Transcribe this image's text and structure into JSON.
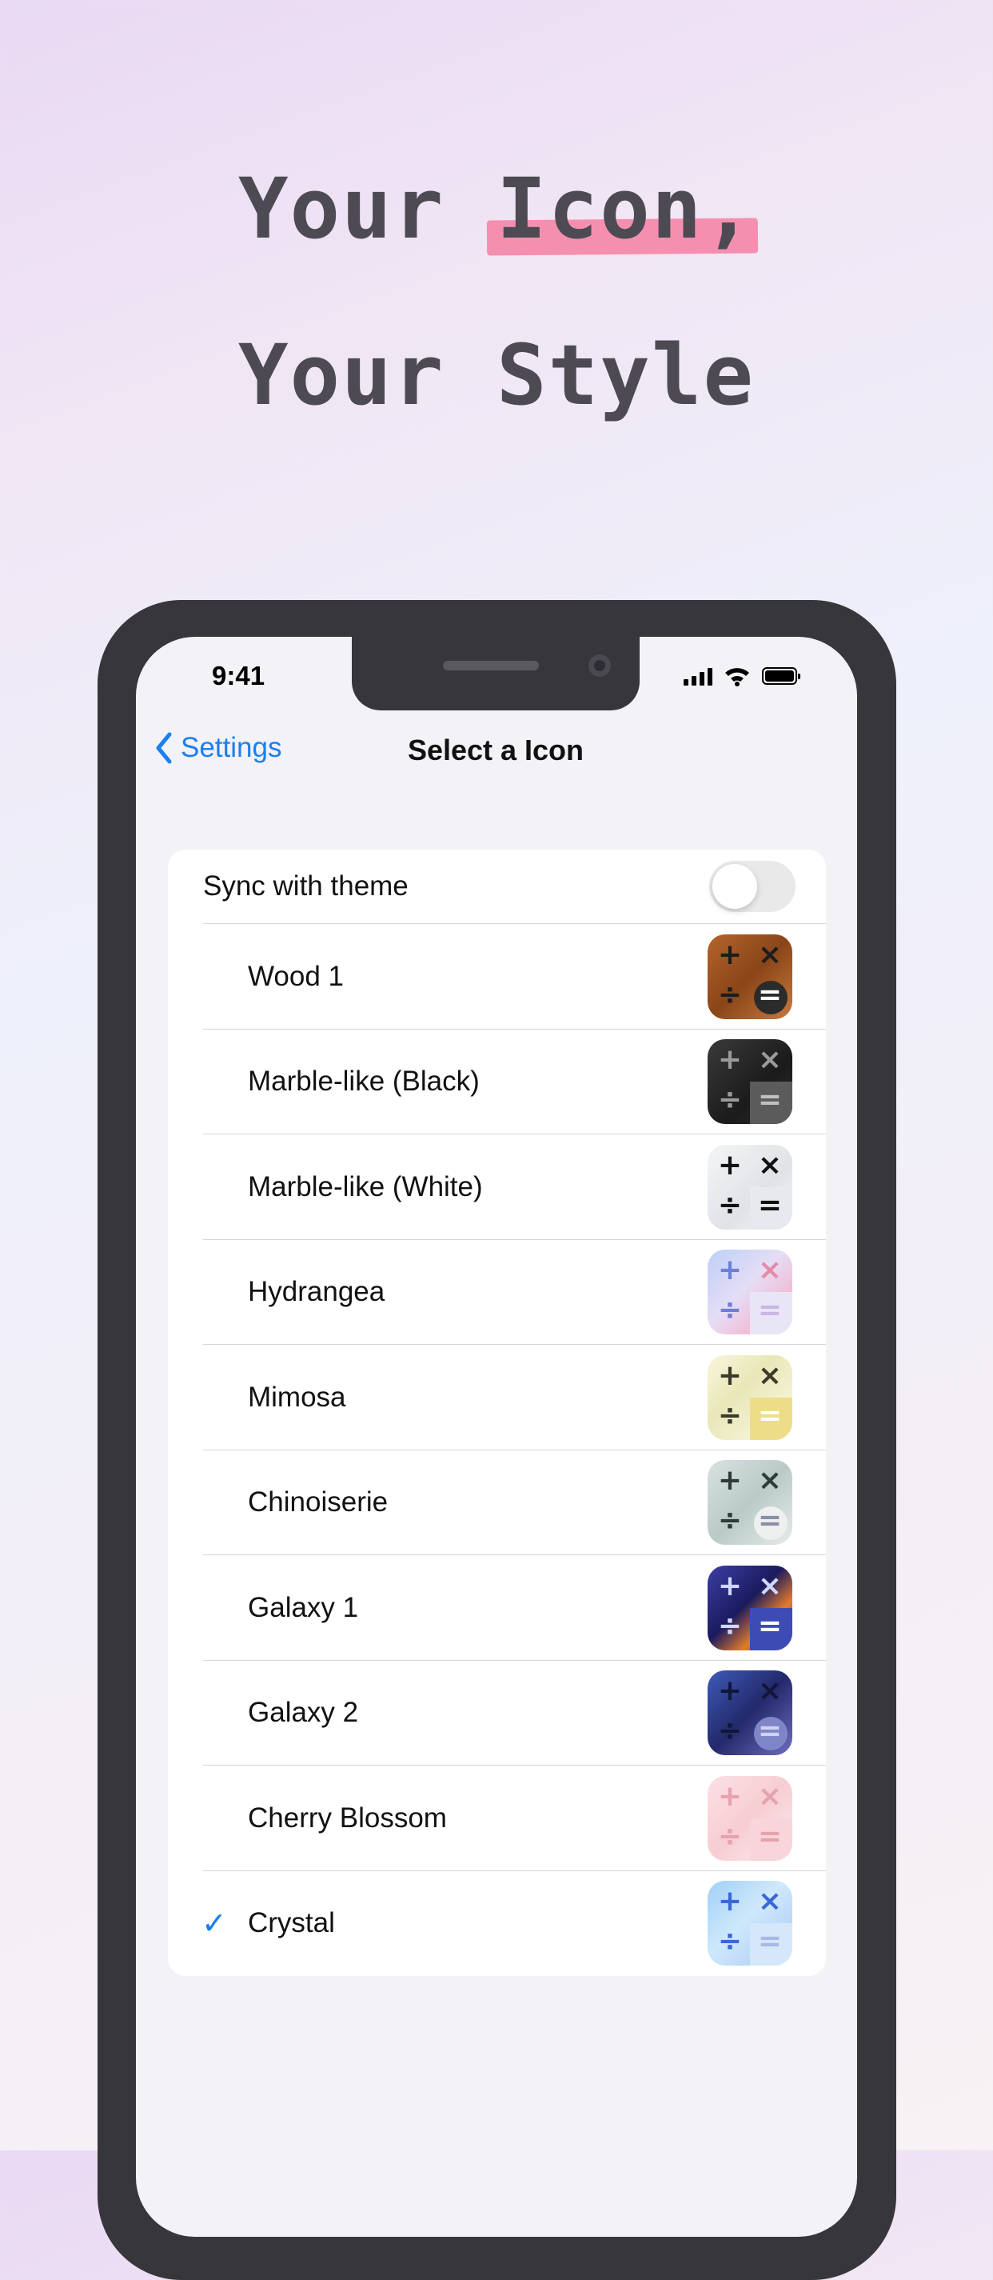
{
  "headline": {
    "line1_a": "Your ",
    "line1_b": "Icon,",
    "line2": "Your Style"
  },
  "status_bar": {
    "time": "9:41"
  },
  "nav": {
    "back_label": "Settings",
    "title": "Select a Icon"
  },
  "sync": {
    "label": "Sync with theme",
    "enabled": false
  },
  "icons": [
    {
      "label": "Wood 1",
      "selected": false,
      "style": "wood"
    },
    {
      "label": "Marble-like (Black)",
      "selected": false,
      "style": "marble-black"
    },
    {
      "label": "Marble-like (White)",
      "selected": false,
      "style": "marble-white"
    },
    {
      "label": "Hydrangea",
      "selected": false,
      "style": "hydrangea"
    },
    {
      "label": "Mimosa",
      "selected": false,
      "style": "mimosa"
    },
    {
      "label": "Chinoiserie",
      "selected": false,
      "style": "chinoiserie"
    },
    {
      "label": "Galaxy 1",
      "selected": false,
      "style": "galaxy1"
    },
    {
      "label": "Galaxy 2",
      "selected": false,
      "style": "galaxy2"
    },
    {
      "label": "Cherry Blossom",
      "selected": false,
      "style": "cherry"
    },
    {
      "label": "Crystal",
      "selected": true,
      "style": "crystal"
    }
  ],
  "glyphs": {
    "plus": "+",
    "times": "×",
    "divide": "÷",
    "equals": "=",
    "check": "✓"
  },
  "colors": {
    "accent": "#1a7ff0",
    "headline": "#4d4a53",
    "highlight": "#f58fb0"
  }
}
